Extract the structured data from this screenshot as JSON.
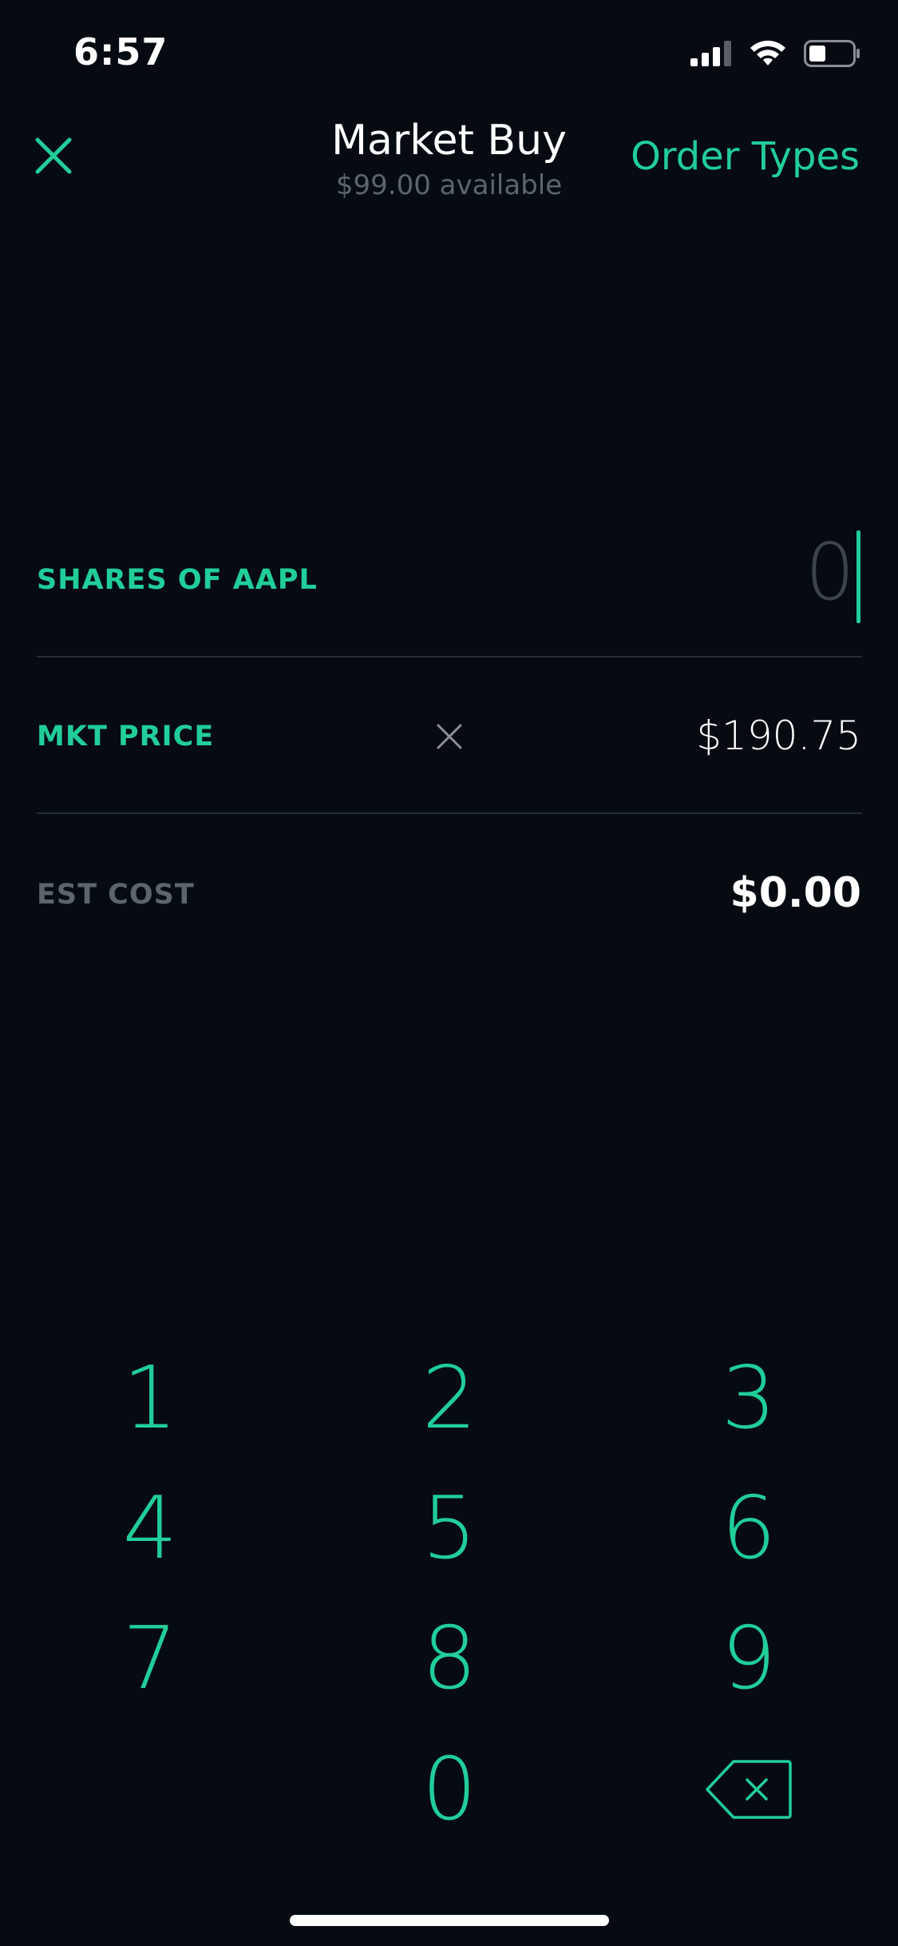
{
  "status_bar": {
    "time": "6:57"
  },
  "header": {
    "title": "Market Buy",
    "subtitle": "$99.00 available",
    "order_types_label": "Order Types"
  },
  "shares": {
    "label": "SHARES OF AAPL",
    "value": "0"
  },
  "market_price": {
    "label": "MKT PRICE",
    "value": "$190.75"
  },
  "est_cost": {
    "label": "EST COST",
    "value": "$0.00"
  },
  "keypad": {
    "keys": [
      "1",
      "2",
      "3",
      "4",
      "5",
      "6",
      "7",
      "8",
      "9",
      "0"
    ]
  },
  "colors": {
    "accent": "#21ce99",
    "background": "#060b12",
    "muted": "#5c656d"
  }
}
